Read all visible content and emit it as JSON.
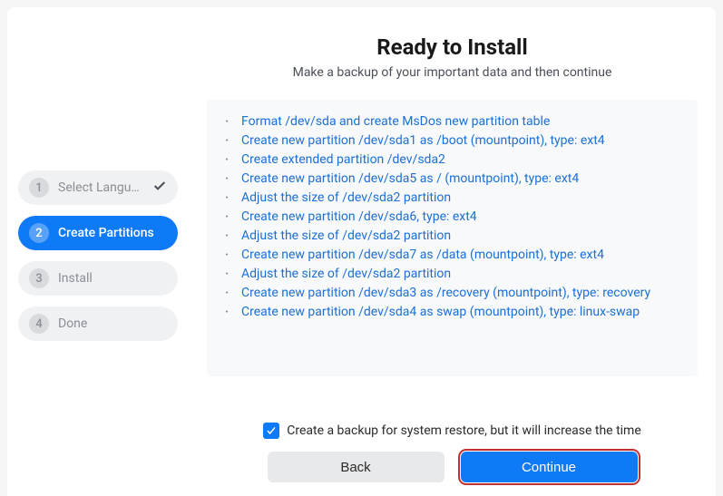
{
  "sidebar": {
    "steps": [
      {
        "num": "1",
        "label": "Select Langu…",
        "done": true
      },
      {
        "num": "2",
        "label": "Create Partitions",
        "active": true
      },
      {
        "num": "3",
        "label": "Install"
      },
      {
        "num": "4",
        "label": "Done"
      }
    ]
  },
  "main": {
    "title": "Ready to Install",
    "subtitle": "Make a backup of your important data and then continue",
    "actions": [
      "Format /dev/sda and create MsDos new partition table",
      "Create new partition /dev/sda1 as /boot (mountpoint), type: ext4",
      "Create extended partition /dev/sda2",
      "Create new partition /dev/sda5 as / (mountpoint), type: ext4",
      "Adjust the size of /dev/sda2 partition",
      "Create new partition /dev/sda6, type: ext4",
      "Adjust the size of /dev/sda2 partition",
      "Create new partition /dev/sda7 as /data (mountpoint), type: ext4",
      "Adjust the size of /dev/sda2 partition",
      "Create new partition /dev/sda3 as /recovery (mountpoint), type: recovery",
      "Create new partition /dev/sda4 as swap (mountpoint), type: linux-swap"
    ],
    "backup_checkbox": {
      "checked": true,
      "label": "Create a backup for system restore, but it will increase the time"
    },
    "buttons": {
      "back": "Back",
      "continue": "Continue"
    }
  }
}
